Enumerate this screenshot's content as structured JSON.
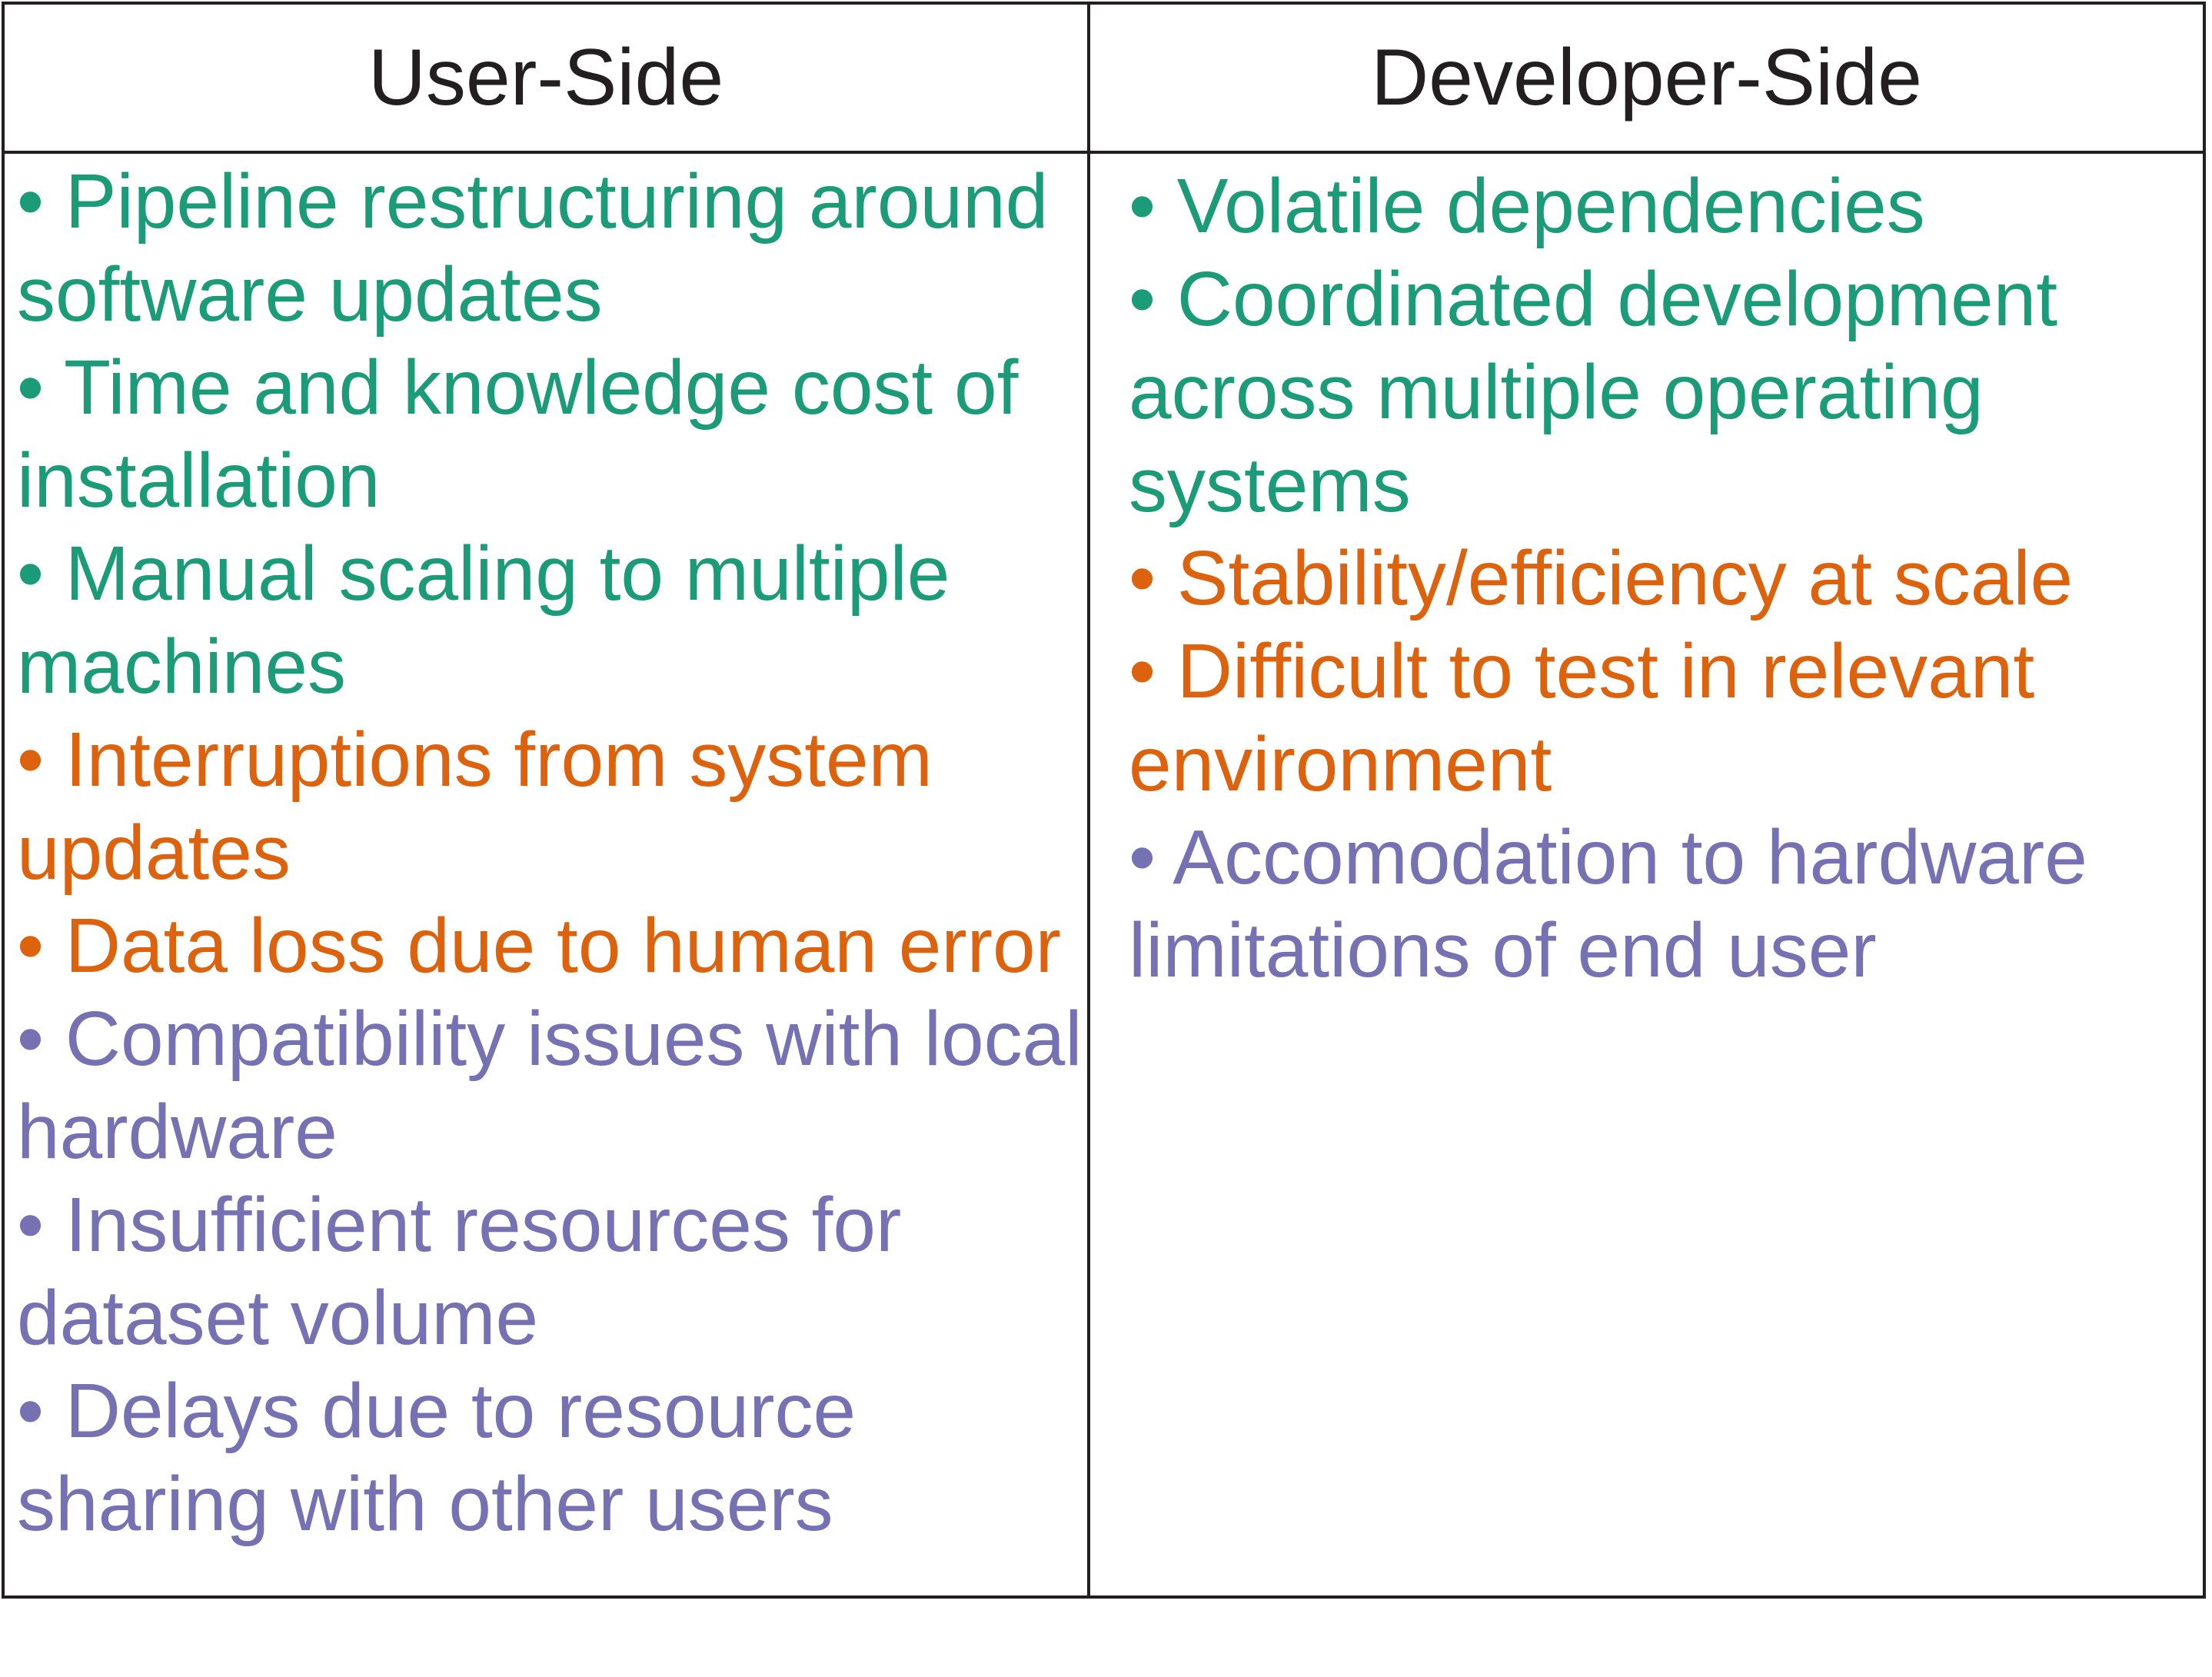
{
  "table": {
    "headers": {
      "user_side": "User-Side",
      "developer_side": "Developer-Side"
    },
    "colors": {
      "green": "#1c9b79",
      "orange": "#dd620e",
      "purple": "#7571b3",
      "border": "#231f20"
    },
    "user_side_items": [
      {
        "text": "• Pipeline restructuring around software updates",
        "color": "green"
      },
      {
        "text": "• Time and knowledge cost of installation",
        "color": "green"
      },
      {
        "text": "• Manual scaling to multiple machines",
        "color": "green"
      },
      {
        "text": "• Interruptions from system updates",
        "color": "orange"
      },
      {
        "text": "• Data loss due to human error",
        "color": "orange"
      },
      {
        "text": "• Compatibility issues with local hardware",
        "color": "purple"
      },
      {
        "text": "• Insufficient resources for dataset volume",
        "color": "purple"
      },
      {
        "text": "• Delays due to resource sharing with other users",
        "color": "purple"
      }
    ],
    "developer_side_items": [
      {
        "text": "• Volatile dependencies",
        "color": "green"
      },
      {
        "text": "• Coordinated development across multiple operating systems",
        "color": "green"
      },
      {
        "text": "• Stability/efficiency at scale",
        "color": "orange"
      },
      {
        "text": "• Difficult to test in relevant environment",
        "color": "orange"
      },
      {
        "text": "• Accomodation to hardware limitations of end user",
        "color": "purple"
      }
    ]
  }
}
